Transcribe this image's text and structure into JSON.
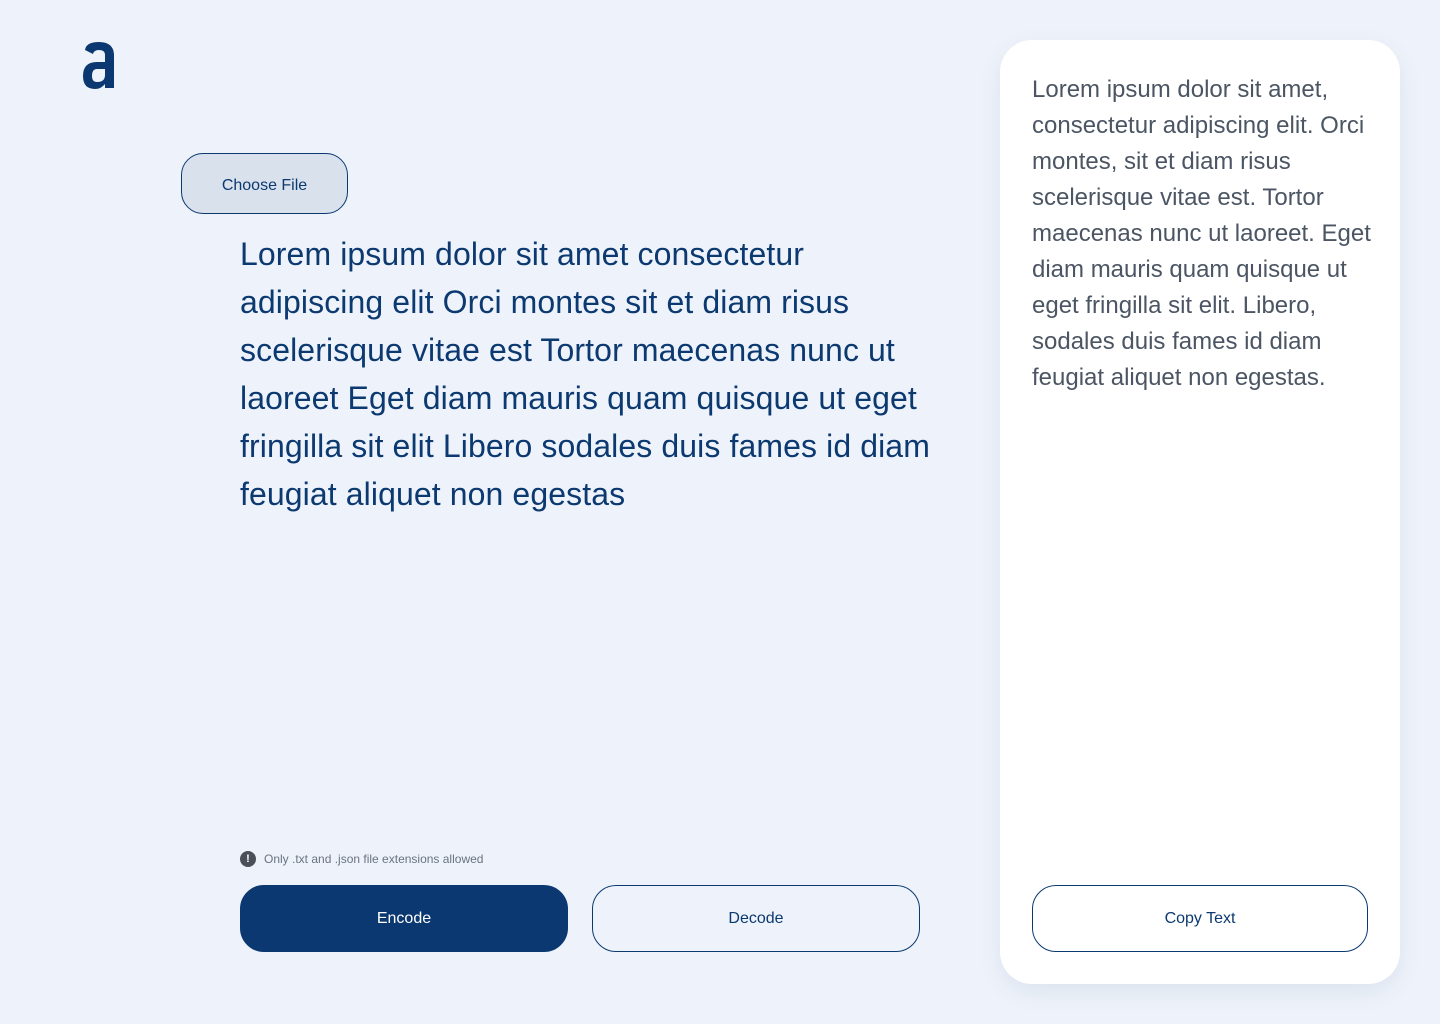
{
  "brand": {
    "logo_icon": "letter-a-logo-icon",
    "color": "#0b3870"
  },
  "upload": {
    "choose_file_label": "Choose File"
  },
  "editor": {
    "input_text": "Lorem ipsum dolor sit amet consectetur adipiscing elit Orci montes sit et diam risus scelerisque vitae est Tortor maecenas nunc ut laoreet Eget diam mauris quam quisque ut eget fringilla sit elit Libero sodales duis fames id diam feugiat aliquet non egestas"
  },
  "hint": {
    "icon": "exclamation-circle-icon",
    "text": "Only .txt and .json file extensions allowed"
  },
  "actions": {
    "encode_label": "Encode",
    "decode_label": "Decode"
  },
  "output": {
    "text": "Lorem ipsum dolor sit amet, consectetur adipiscing elit. Orci montes, sit et diam risus scelerisque vitae est. Tortor maecenas nunc ut laoreet. Eget diam mauris quam quisque ut eget fringilla sit elit. Libero, sodales duis fames id diam feugiat aliquet non egestas.",
    "copy_label": "Copy Text"
  },
  "colors": {
    "background": "#eef3fb",
    "primary": "#0b3870",
    "panel": "#ffffff"
  }
}
